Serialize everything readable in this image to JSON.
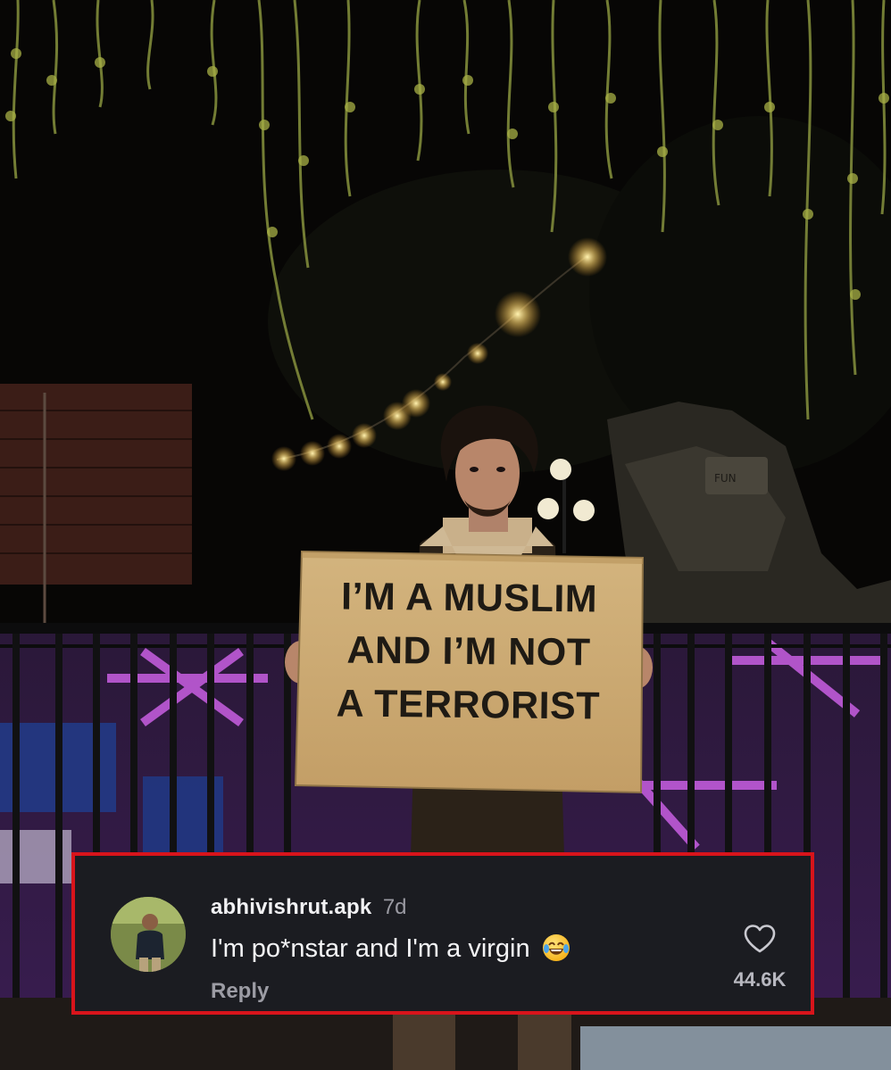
{
  "sign": {
    "lines": [
      "I’M A MUSLIM",
      "AND I’M NOT",
      "A TERRORIST"
    ]
  },
  "comment": {
    "username": "abhivishrut.apk",
    "age": "7d",
    "text": "I'm po*nstar and I'm a virgin",
    "emoji": "face-with-tears-of-joy",
    "reply_label": "Reply",
    "like_count": "44.6K"
  },
  "colors": {
    "highlight_border": "#d8141b",
    "card_background": "#1b1c21",
    "cardboard": "#c9a873"
  }
}
